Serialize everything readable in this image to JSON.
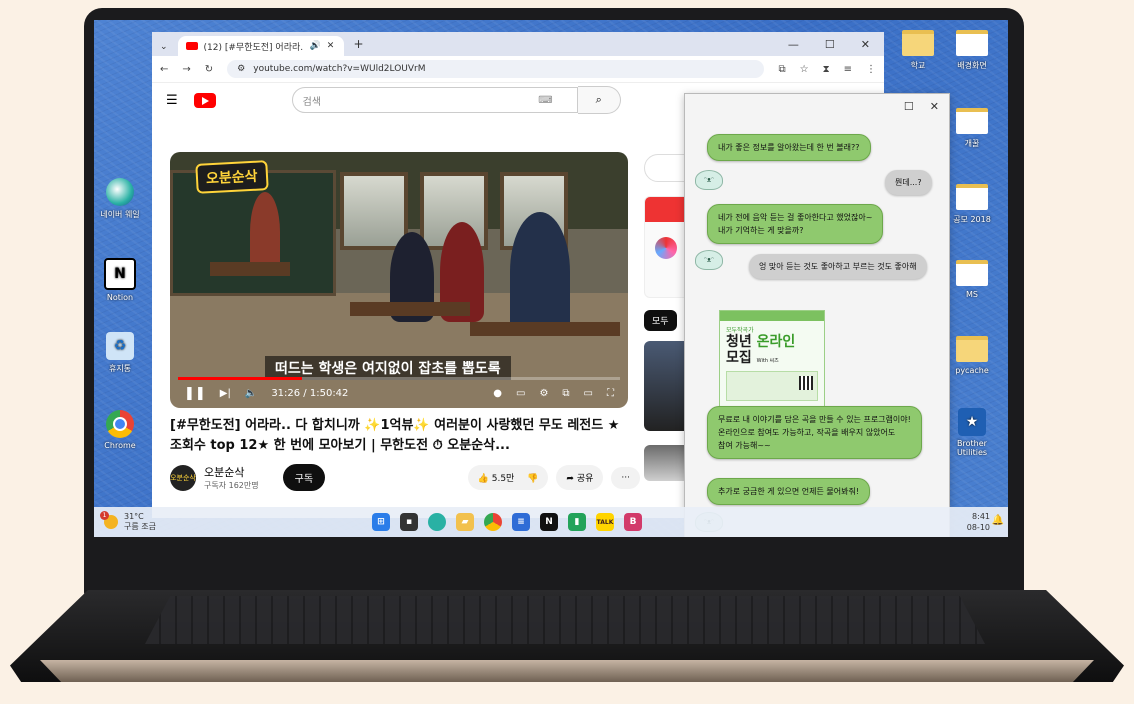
{
  "desktop": {
    "icons_left": [
      {
        "label": "네이버 웨일",
        "icon": "whale-icon"
      },
      {
        "label": "Notion",
        "icon": "notion-icon"
      },
      {
        "label": "휴지통",
        "icon": "recycle-bin-icon"
      },
      {
        "label": "Chrome",
        "icon": "chrome-icon"
      }
    ],
    "icons_right": [
      {
        "label": "학교",
        "icon": "folder-icon"
      },
      {
        "label": "배경화면",
        "icon": "folder-icon"
      },
      {
        "label": "개꿀",
        "icon": "folder-icon"
      },
      {
        "label": "공모 2018",
        "icon": "folder-icon"
      },
      {
        "label": "MS",
        "icon": "folder-icon"
      },
      {
        "label": "pycache",
        "icon": "folder-icon"
      },
      {
        "label": "Brother Utilities",
        "icon": "brother-icon"
      }
    ]
  },
  "browser": {
    "tab_title": "(12) [#무한도전] 어라라.. ",
    "url": "youtube.com/watch?v=WUld2LOUVrM",
    "search_placeholder": "검색"
  },
  "video": {
    "channel_logo_text": "오분순삭",
    "subtitle": "떠드는 학생은 여지없이 잡초를 뽑도록",
    "time": "31:26 / 1:50:42",
    "progress": 0.28,
    "title": "[#무한도전] 어라라.. 다 합치니까 ✨1억뷰✨ 여러분이 사랑했던 무도 레전드 ★조회수 top 12★ 한 번에 모아보기 | 무한도전 ⏱ 오분순삭...",
    "channel_name": "오분순삭",
    "subscribers": "구독자 162만명",
    "subscribe_label": "구독",
    "likes": "5.5만",
    "share_label": "공유",
    "more_label": "···"
  },
  "sidebar": {
    "chip_all": "모두"
  },
  "chat": {
    "messages": [
      {
        "text": "내가 좋은 정보를 알아왔는데 한 번 볼래??",
        "type": "green"
      },
      {
        "text": "뭔데...?",
        "type": "gray"
      },
      {
        "text": "네가 전에 음악 듣는 걸 좋아한다고 했었잖아~\n내가 기억하는 게 맞을까?",
        "type": "green"
      },
      {
        "text": "엉 맞아 듣는 것도 좋아하고 부르는 것도 좋아해",
        "type": "gray"
      },
      {
        "text": "무료로 내 이야기를 담은 곡을 만들 수 있는 프로그램이야!\n온라인으로 참여도 가능하고, 작곡을 배우지 않았어도\n참여 가능해~~",
        "type": "green"
      },
      {
        "text": "추가로 궁금한 게 있으면 언제든 물어봐줘!",
        "type": "green"
      }
    ],
    "poster": {
      "tag": "모두작곡가",
      "line1": "청년 ",
      "line1_hl": "온라인",
      "line2": "모집",
      "with": "With 씨즈"
    }
  },
  "taskbar": {
    "temperature": "31°C",
    "weather": "구름 조금",
    "time": "8:41",
    "date": "08-10",
    "notification_count": "1"
  }
}
